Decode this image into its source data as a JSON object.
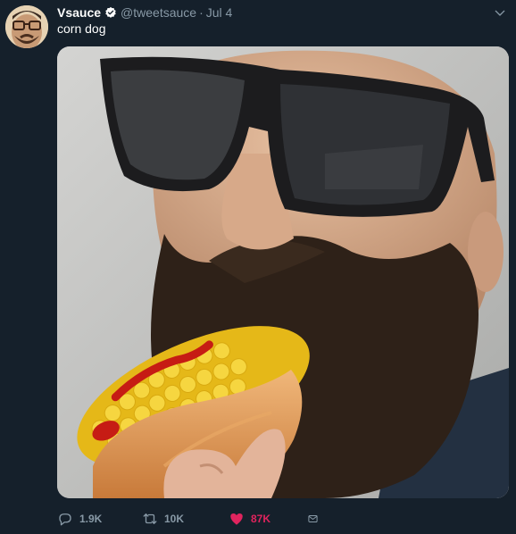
{
  "tweet": {
    "author_name": "Vsauce",
    "handle": "@tweetsauce",
    "separator": "·",
    "date": "Jul 4",
    "text": "corn dog",
    "actions": {
      "reply_count": "1.9K",
      "retweet_count": "10K",
      "like_count": "87K"
    }
  },
  "icons": {
    "verified": "verified-badge-icon",
    "caret": "chevron-down-icon",
    "reply": "reply-icon",
    "retweet": "retweet-icon",
    "like": "heart-icon",
    "dm": "mail-icon"
  },
  "colors": {
    "background": "#15202b",
    "muted": "#8899a6",
    "like": "#e0245e",
    "verified": "#ffffff"
  }
}
